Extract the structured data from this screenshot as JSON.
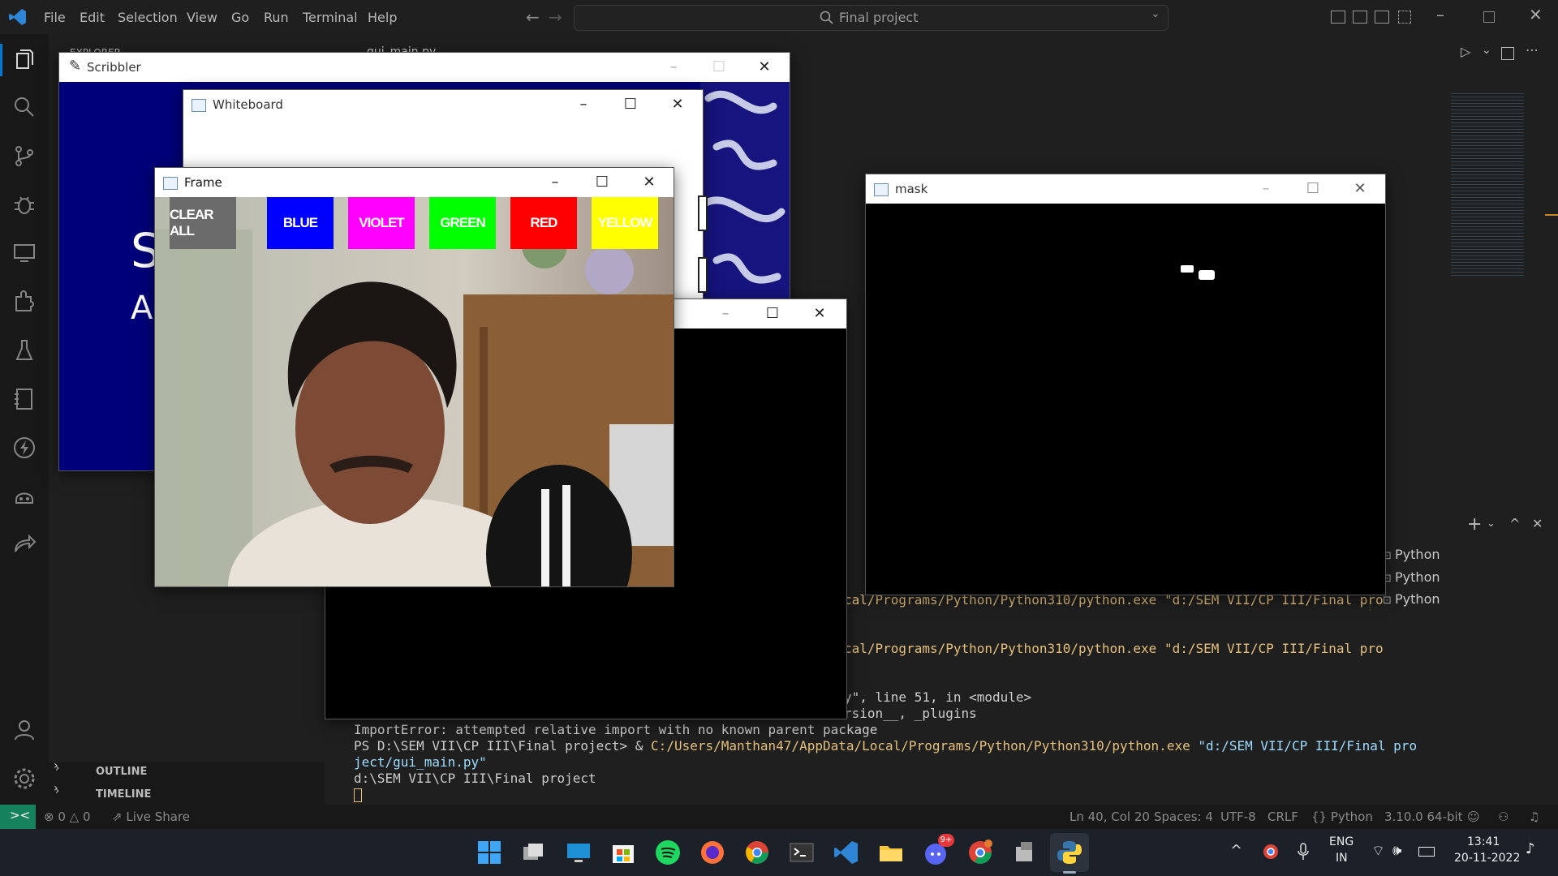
{
  "vscode": {
    "menus": [
      "File",
      "Edit",
      "Selection",
      "View",
      "Go",
      "Run",
      "Terminal",
      "Help"
    ],
    "search_text": "Final project",
    "explorer_label": "EXPLORER",
    "editor_tab": "gui_main.py",
    "outline_label": "OUTLINE",
    "timeline_label": "TIMELINE"
  },
  "status": {
    "errors": "0",
    "warnings": "0",
    "live_share": "Live Share",
    "position": "Ln 40, Col 20",
    "spaces": "Spaces: 4",
    "encoding": "UTF-8",
    "eol": "CRLF",
    "language": "Python",
    "interpreter": "3.10.0 64-bit"
  },
  "terminal": {
    "line1": "cal/Programs/Python/Python310/python.exe \"d:/SEM VII/CP III/Final pro",
    "line2": "cal/Programs/Python/Python310/python.exe \"d:/SEM VII/CP III/Final pro",
    "line3": "y\", line 51, in <module>",
    "line4": "rsion__, _plugins",
    "line5": "ImportError: attempted relative import with no known parent package",
    "line6_prompt": "PS D:\\SEM VII\\CP III\\Final project> & ",
    "line6_cmd": "C:/Users/Manthan47/AppData/Local/Programs/Python/Python310/python.exe",
    "line6_arg": " \"d:/SEM VII/CP III/Final pro",
    "line7": "ject/gui_main.py\"",
    "line8": "d:\\SEM VII\\CP III\\Final project",
    "panel_tabs": [
      "Python",
      "Python",
      "Python"
    ]
  },
  "windows": {
    "scribbler_title": "Scribbler",
    "scribbler_text1": "S",
    "scribbler_text2": "A",
    "whiteboard_title": "Whiteboard",
    "frame_title": "Frame",
    "mask_title": "mask",
    "frame_buttons": [
      {
        "label": "CLEAR ALL",
        "color": "#6b6b6b"
      },
      {
        "label": "BLUE",
        "color": "#0000ff"
      },
      {
        "label": "VIOLET",
        "color": "#ff00ff"
      },
      {
        "label": "GREEN",
        "color": "#00ff00"
      },
      {
        "label": "RED",
        "color": "#ff0000"
      },
      {
        "label": "YELLOW",
        "color": "#ffff00"
      }
    ]
  },
  "taskbar": {
    "lang_top": "ENG",
    "lang_bottom": "IN",
    "time": "13:41",
    "date": "20-11-2022",
    "discord_badge": "9+"
  }
}
